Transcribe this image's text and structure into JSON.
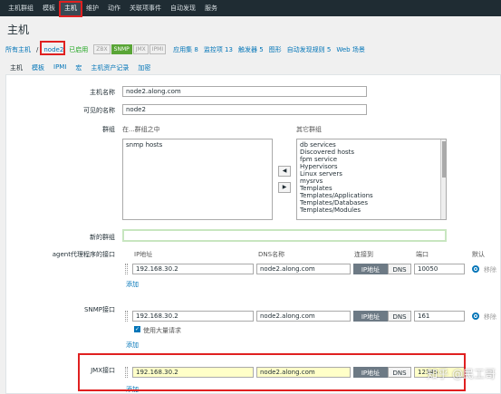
{
  "topbar": {
    "menus": [
      "主机群组",
      "模板",
      "主机",
      "维护",
      "动作",
      "关联项事件",
      "自动发现",
      "服务"
    ]
  },
  "page": {
    "title": "主机"
  },
  "subnav": {
    "all_hosts": "所有主机",
    "separator": "/",
    "host": "node2",
    "enabled": "已启用",
    "tags": [
      "ZBX",
      "SNMP",
      "JMX",
      "IPMI"
    ],
    "links": [
      "应用集 8",
      "监控项 13",
      "触发器 5",
      "图形",
      "自动发现规则 5",
      "Web 场景"
    ]
  },
  "tabs": [
    "主机",
    "模板",
    "IPMI",
    "宏",
    "主机资产记录",
    "加密"
  ],
  "form": {
    "host_name_label": "主机名称",
    "host_name_value": "node2.along.com",
    "visible_name_label": "可见的名称",
    "visible_name_value": "node2",
    "groups_label": "群组",
    "in_groups_label": "在...群组之中",
    "other_groups_label": "其它群组",
    "in_groups": [
      "snmp hosts"
    ],
    "other_groups": [
      "db services",
      "Discovered hosts",
      "fpm service",
      "Hypervisors",
      "Linux servers",
      "mysrvs",
      "Templates",
      "Templates/Applications",
      "Templates/Databases",
      "Templates/Modules"
    ],
    "btn_left": "◀",
    "btn_right": "▶",
    "new_group_label": "新的群组",
    "new_group_value": "",
    "interfaces": {
      "header_ip": "IP地址",
      "header_dns": "DNS名称",
      "header_connect": "连接到",
      "header_port": "端口",
      "header_default": "默认",
      "ip_btn": "IP地址",
      "dns_btn": "DNS",
      "remove": "移除",
      "add": "添加",
      "agent": {
        "label": "agent代理程序的接口",
        "ip": "192.168.30.2",
        "dns": "node2.along.com",
        "port": "10050"
      },
      "snmp": {
        "label": "SNMP接口",
        "ip": "192.168.30.2",
        "dns": "node2.along.com",
        "port": "161",
        "bulk": "使用大量请求"
      },
      "jmx": {
        "label": "JMX接口",
        "ip": "192.168.30.2",
        "dns": "node2.along.com",
        "port": "12345"
      }
    }
  },
  "watermark": "知乎 @民工哥"
}
